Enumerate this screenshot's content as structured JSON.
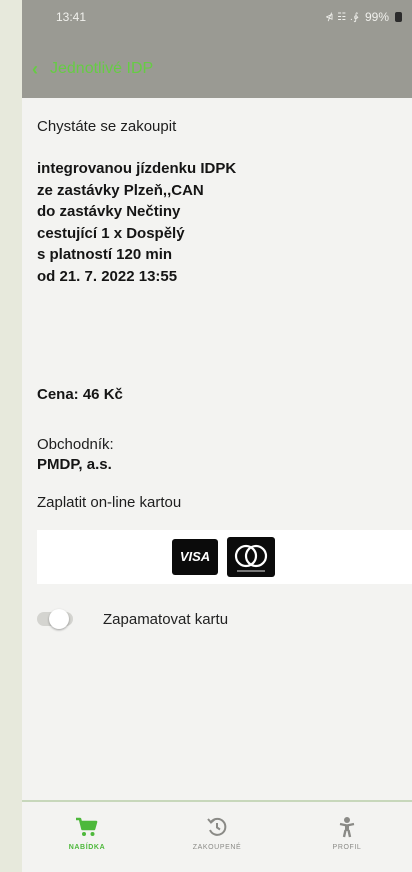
{
  "status_bar": {
    "time": "13:41",
    "network": "⋪ ☷ .∳",
    "battery": "99%"
  },
  "app_bar": {
    "title": "Jednotlivé IDP"
  },
  "purchase": {
    "intro": "Chystáte se zakoupit",
    "ticket_lines": [
      "integrovanou jízdenku IDPK",
      "ze zastávky Plzeň,,CAN",
      "do zastávky Nečtiny",
      "cestující 1 x Dospělý",
      "s platností 120 min",
      "od 21. 7. 2022 13:55"
    ],
    "price": "Cena: 46 Kč",
    "merchant_label": "Obchodník:",
    "merchant_name": "PMDP, a.s.",
    "pay_label": "Zaplatit on-line kartou",
    "visa_label": "VISA",
    "remember_label": "Zapamatovat kartu",
    "remember_enabled": false
  },
  "bottom_nav": {
    "items": [
      {
        "label": "NABÍDKA",
        "icon": "cart-icon",
        "active": true
      },
      {
        "label": "ZAKOUPENÉ",
        "icon": "history-icon",
        "active": false
      },
      {
        "label": "PROFIL",
        "icon": "person-icon",
        "active": false
      }
    ]
  },
  "colors": {
    "accent_green": "#4db83b",
    "header_gray": "#9a9a93",
    "background": "#f3f3f1"
  }
}
